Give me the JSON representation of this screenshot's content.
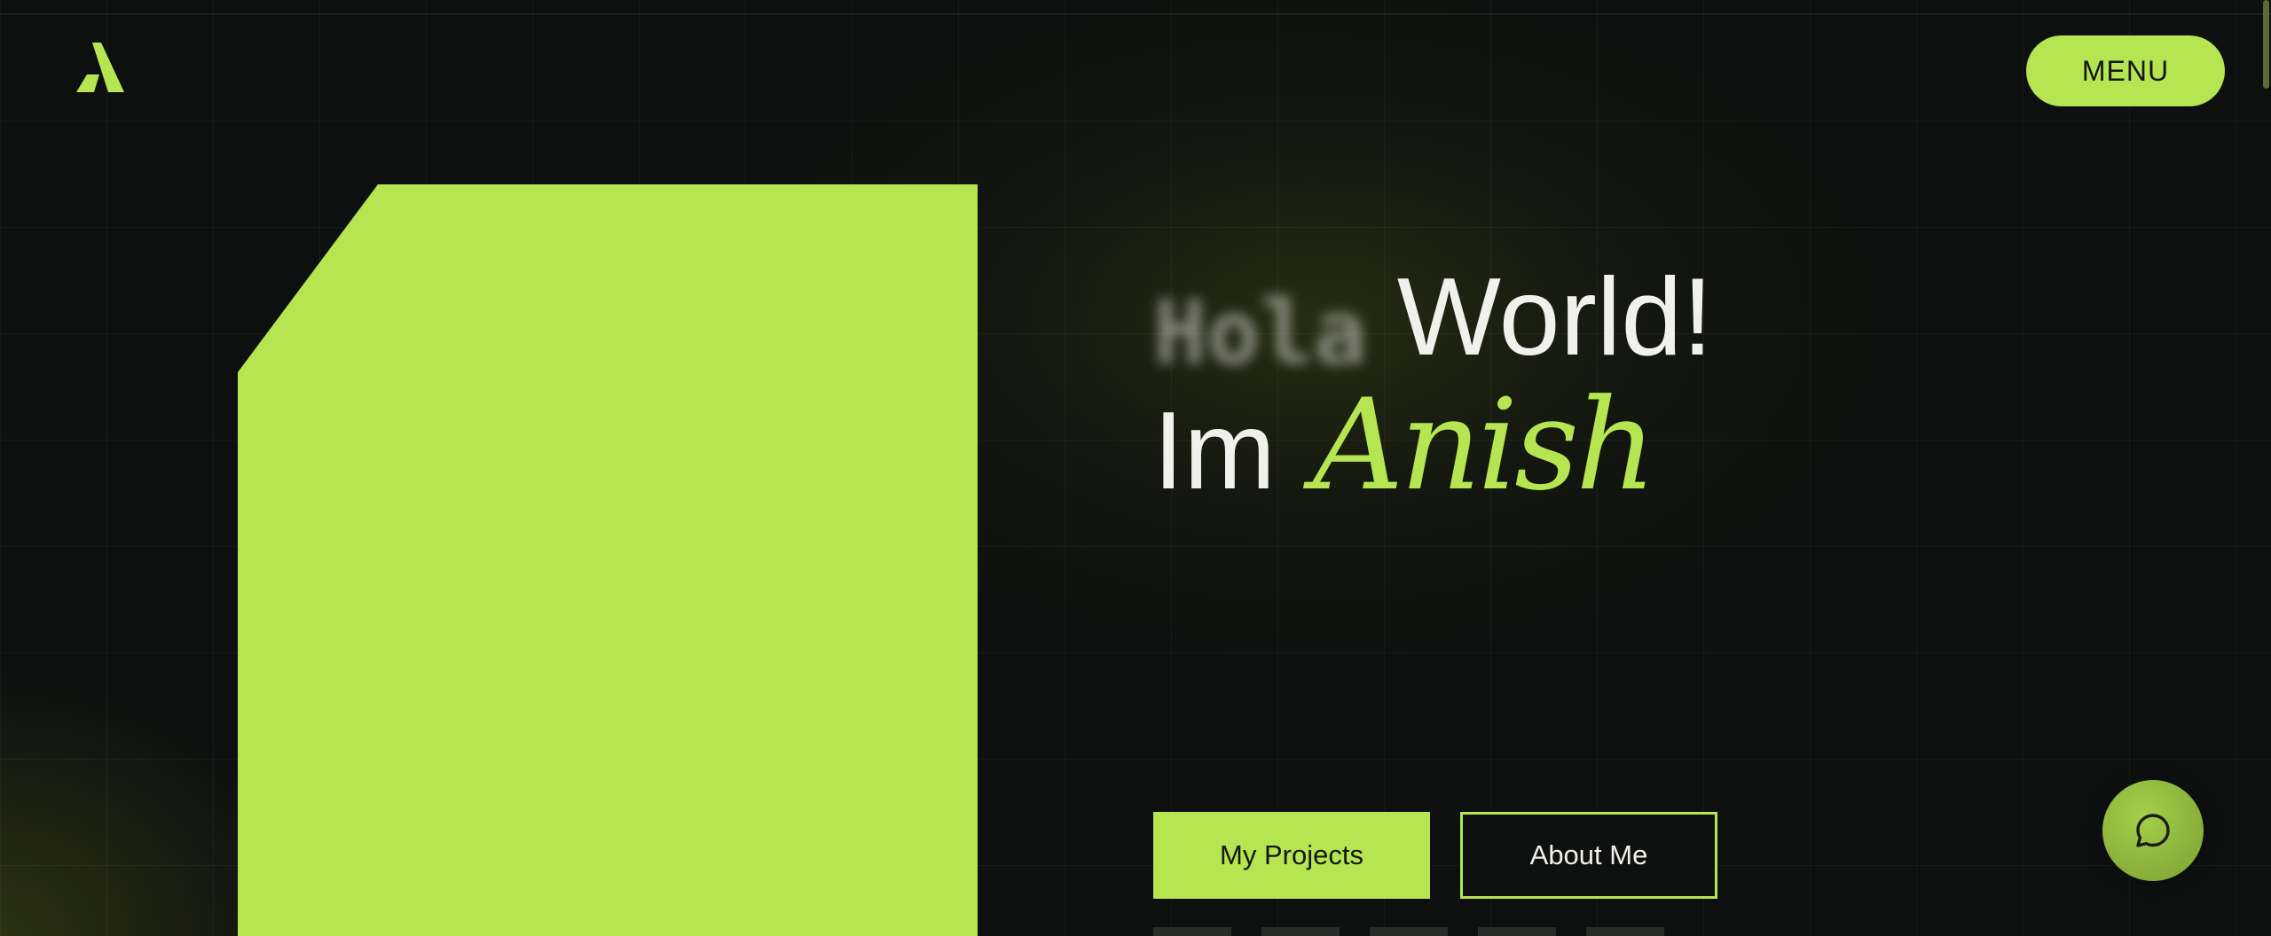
{
  "header": {
    "logo_icon": "a-letter-logo-icon",
    "menu_label": "MENU"
  },
  "hero": {
    "blurred_word": "Hola",
    "greeting_word": "World!",
    "intro_prefix": "Im",
    "name": "Anish",
    "primary_button_label": "My Projects",
    "secondary_button_label": "About Me"
  },
  "chat": {
    "icon": "chat-bubble-icon"
  },
  "colors": {
    "accent": "#b5e550",
    "background": "#0e100f",
    "text": "#f1f1ec"
  }
}
